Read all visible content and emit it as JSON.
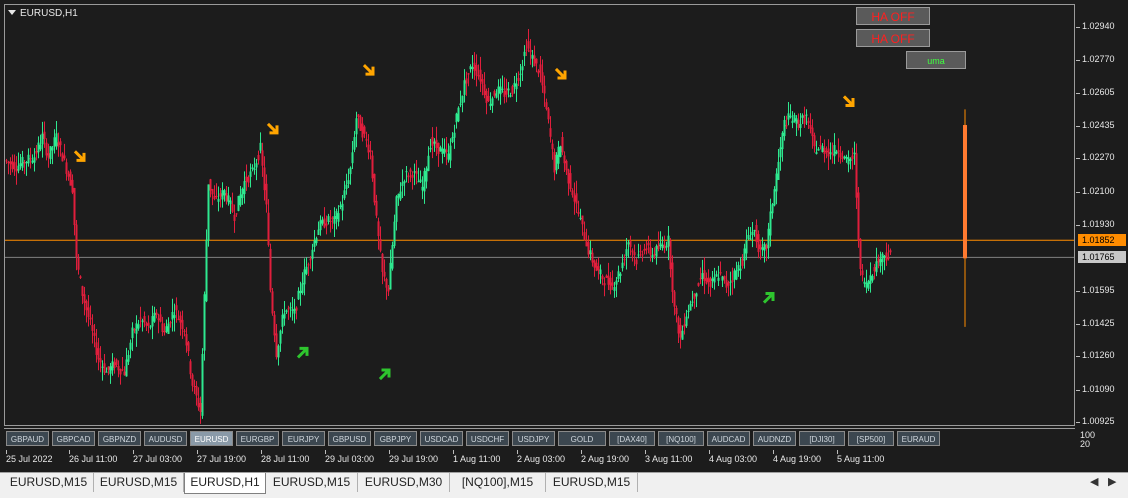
{
  "chart": {
    "title": "EURUSD,H1",
    "bullish_color": "#2ee88f",
    "bearish_color": "#e01e3c",
    "level_line_color": "#ff8c00",
    "current_line_color": "#808080",
    "up_arrow_color": "#2ec52e",
    "down_arrow_color": "#ffa500"
  },
  "price_axis": {
    "ticks": [
      "1.02940",
      "1.02770",
      "1.02605",
      "1.02435",
      "1.02270",
      "1.02100",
      "1.01930",
      "1.01595",
      "1.01425",
      "1.01260",
      "1.01090",
      "1.00925"
    ],
    "level_label": "1.01852",
    "current_label": "1.01765",
    "sub_scale_top": "100",
    "sub_scale_bottom": "20"
  },
  "time_axis": {
    "labels": [
      "25 Jul 2022",
      "26 Jul 11:00",
      "27 Jul 03:00",
      "27 Jul 19:00",
      "28 Jul 11:00",
      "29 Jul 03:00",
      "29 Jul 19:00",
      "1 Aug 11:00",
      "2 Aug 03:00",
      "2 Aug 19:00",
      "3 Aug 11:00",
      "4 Aug 03:00",
      "4 Aug 19:00",
      "5 Aug 11:00"
    ]
  },
  "buttons": {
    "ha_off_1": "HA OFF",
    "ha_off_2": "HA OFF",
    "uma": "uma"
  },
  "symbols": [
    {
      "label": "GBPAUD",
      "active": false
    },
    {
      "label": "GBPCAD",
      "active": false
    },
    {
      "label": "GBPNZD",
      "active": false
    },
    {
      "label": "AUDUSD",
      "active": false
    },
    {
      "label": "EURUSD",
      "active": true
    },
    {
      "label": "EURGBP",
      "active": false
    },
    {
      "label": "EURJPY",
      "active": false
    },
    {
      "label": "GBPUSD",
      "active": false
    },
    {
      "label": "GBPJPY",
      "active": false
    },
    {
      "label": "USDCAD",
      "active": false
    },
    {
      "label": "USDCHF",
      "active": false
    },
    {
      "label": "USDJPY",
      "active": false
    },
    {
      "label": "GOLD",
      "active": false
    },
    {
      "label": "[DAX40]",
      "active": false
    },
    {
      "label": "[NQ100]",
      "active": false
    },
    {
      "label": "AUDCAD",
      "active": false
    },
    {
      "label": "AUDNZD",
      "active": false
    },
    {
      "label": "[DJI30]",
      "active": false
    },
    {
      "label": "[SP500]",
      "active": false
    },
    {
      "label": "EURAUD",
      "active": false
    }
  ],
  "tabs": [
    {
      "label": "EURUSD,M15",
      "active": false
    },
    {
      "label": "EURUSD,M15",
      "active": false
    },
    {
      "label": "EURUSD,H1",
      "active": true
    },
    {
      "label": "EURUSD,M15",
      "active": false
    },
    {
      "label": "EURUSD,M30",
      "active": false
    },
    {
      "label": "[NQ100],M15",
      "active": false
    },
    {
      "label": "EURUSD,M15",
      "active": false
    }
  ],
  "tab_nav": {
    "prev_icon": "triangle-left-icon",
    "next_icon": "triangle-right-icon",
    "prev": "◀",
    "next": "▶"
  },
  "price_path": [
    [
      0,
      1.0226
    ],
    [
      12,
      1.0223
    ],
    [
      22,
      1.0226
    ],
    [
      30,
      1.0228
    ],
    [
      38,
      1.0238
    ],
    [
      44,
      1.0228
    ],
    [
      52,
      1.0238
    ],
    [
      60,
      1.0225
    ],
    [
      68,
      1.0212
    ],
    [
      72,
      1.0175
    ],
    [
      78,
      1.0158
    ],
    [
      86,
      1.0142
    ],
    [
      94,
      1.0125
    ],
    [
      102,
      1.0118
    ],
    [
      110,
      1.0122
    ],
    [
      120,
      1.0118
    ],
    [
      128,
      1.0138
    ],
    [
      136,
      1.0145
    ],
    [
      144,
      1.014
    ],
    [
      152,
      1.0148
    ],
    [
      160,
      1.0138
    ],
    [
      170,
      1.015
    ],
    [
      180,
      1.014
    ],
    [
      188,
      1.0112
    ],
    [
      196,
      1.0098
    ],
    [
      204,
      1.0215
    ],
    [
      210,
      1.0205
    ],
    [
      220,
      1.021
    ],
    [
      230,
      1.0198
    ],
    [
      240,
      1.0215
    ],
    [
      248,
      1.022
    ],
    [
      256,
      1.0232
    ],
    [
      262,
      1.0202
    ],
    [
      266,
      1.016
    ],
    [
      272,
      1.0128
    ],
    [
      280,
      1.015
    ],
    [
      290,
      1.0148
    ],
    [
      298,
      1.0165
    ],
    [
      306,
      1.0178
    ],
    [
      314,
      1.0192
    ],
    [
      322,
      1.0195
    ],
    [
      330,
      1.0195
    ],
    [
      338,
      1.0205
    ],
    [
      346,
      1.0222
    ],
    [
      352,
      1.0248
    ],
    [
      360,
      1.0238
    ],
    [
      366,
      1.023
    ],
    [
      372,
      1.0195
    ],
    [
      378,
      1.0168
    ],
    [
      384,
      1.016
    ],
    [
      392,
      1.0205
    ],
    [
      400,
      1.0218
    ],
    [
      408,
      1.022
    ],
    [
      418,
      1.0212
    ],
    [
      426,
      1.0235
    ],
    [
      434,
      1.0232
    ],
    [
      444,
      1.0228
    ],
    [
      452,
      1.0248
    ],
    [
      460,
      1.0265
    ],
    [
      468,
      1.0275
    ],
    [
      476,
      1.0268
    ],
    [
      484,
      1.0255
    ],
    [
      492,
      1.0262
    ],
    [
      500,
      1.026
    ],
    [
      508,
      1.0262
    ],
    [
      516,
      1.0272
    ],
    [
      522,
      1.0285
    ],
    [
      528,
      1.0278
    ],
    [
      536,
      1.027
    ],
    [
      544,
      1.0245
    ],
    [
      550,
      1.0222
    ],
    [
      556,
      1.0235
    ],
    [
      562,
      1.022
    ],
    [
      568,
      1.021
    ],
    [
      576,
      1.0195
    ],
    [
      584,
      1.018
    ],
    [
      592,
      1.017
    ],
    [
      600,
      1.0165
    ],
    [
      608,
      1.0162
    ],
    [
      616,
      1.017
    ],
    [
      624,
      1.0185
    ],
    [
      632,
      1.0175
    ],
    [
      640,
      1.0182
    ],
    [
      648,
      1.0178
    ],
    [
      656,
      1.0182
    ],
    [
      664,
      1.0185
    ],
    [
      670,
      1.015
    ],
    [
      676,
      1.0135
    ],
    [
      682,
      1.0148
    ],
    [
      690,
      1.0158
    ],
    [
      698,
      1.0168
    ],
    [
      706,
      1.0162
    ],
    [
      714,
      1.0168
    ],
    [
      722,
      1.0162
    ],
    [
      730,
      1.0168
    ],
    [
      738,
      1.0175
    ],
    [
      744,
      1.0188
    ],
    [
      750,
      1.019
    ],
    [
      756,
      1.0178
    ],
    [
      762,
      1.0182
    ],
    [
      768,
      1.0205
    ],
    [
      774,
      1.0225
    ],
    [
      780,
      1.0245
    ],
    [
      786,
      1.0248
    ],
    [
      794,
      1.0245
    ],
    [
      802,
      1.0248
    ],
    [
      810,
      1.0232
    ],
    [
      818,
      1.0232
    ],
    [
      826,
      1.023
    ],
    [
      834,
      1.0232
    ],
    [
      842,
      1.0225
    ],
    [
      850,
      1.0228
    ],
    [
      856,
      1.0168
    ],
    [
      862,
      1.0162
    ],
    [
      868,
      1.017
    ],
    [
      874,
      1.0175
    ],
    [
      880,
      1.0178
    ],
    [
      886,
      1.0177
    ]
  ],
  "last_bar": {
    "open": 1.0176,
    "close": 1.0244,
    "high": 1.0252,
    "low": 1.0141
  },
  "signals": [
    {
      "type": "down",
      "t": 75,
      "p": 1.0228
    },
    {
      "type": "down",
      "t": 268,
      "p": 1.0242
    },
    {
      "type": "down",
      "t": 364,
      "p": 1.0272
    },
    {
      "type": "down",
      "t": 556,
      "p": 1.027
    },
    {
      "type": "down",
      "t": 844,
      "p": 1.0256
    },
    {
      "type": "up",
      "t": 298,
      "p": 1.0128
    },
    {
      "type": "up",
      "t": 380,
      "p": 1.0117
    },
    {
      "type": "up",
      "t": 764,
      "p": 1.0156
    }
  ]
}
